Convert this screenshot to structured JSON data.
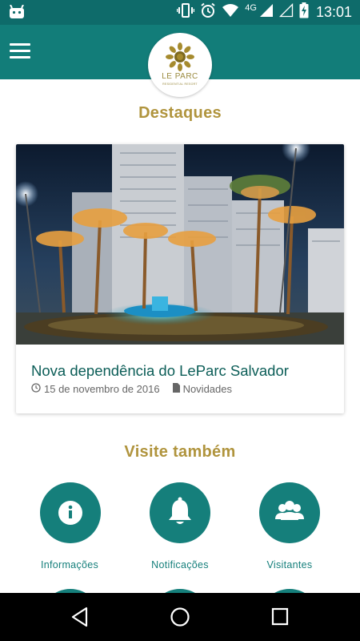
{
  "status_bar": {
    "time": "13:01",
    "network": "4G",
    "icons": [
      "android-icon",
      "vibrate-icon",
      "alarm-icon",
      "wifi-icon",
      "signal-icon",
      "signal-empty-icon",
      "battery-charging-icon"
    ]
  },
  "app_bar": {
    "logo_text": "LE PARC",
    "logo_subtext": "RESIDENTIAL RESORT"
  },
  "highlights": {
    "title": "Destaques",
    "card": {
      "title": "Nova dependência do LeParc Salvador",
      "date": "15 de novembro de 2016",
      "category": "Novidades"
    }
  },
  "visit": {
    "title": "Visite também",
    "items": [
      {
        "label": "Informações",
        "icon": "info-icon"
      },
      {
        "label": "Notificações",
        "icon": "bell-icon"
      },
      {
        "label": "Visitantes",
        "icon": "people-icon"
      }
    ]
  },
  "colors": {
    "status_bar": "#0e6b6a",
    "app_bar": "#127d79",
    "accent": "#157f7b",
    "gold": "#b0943d"
  }
}
